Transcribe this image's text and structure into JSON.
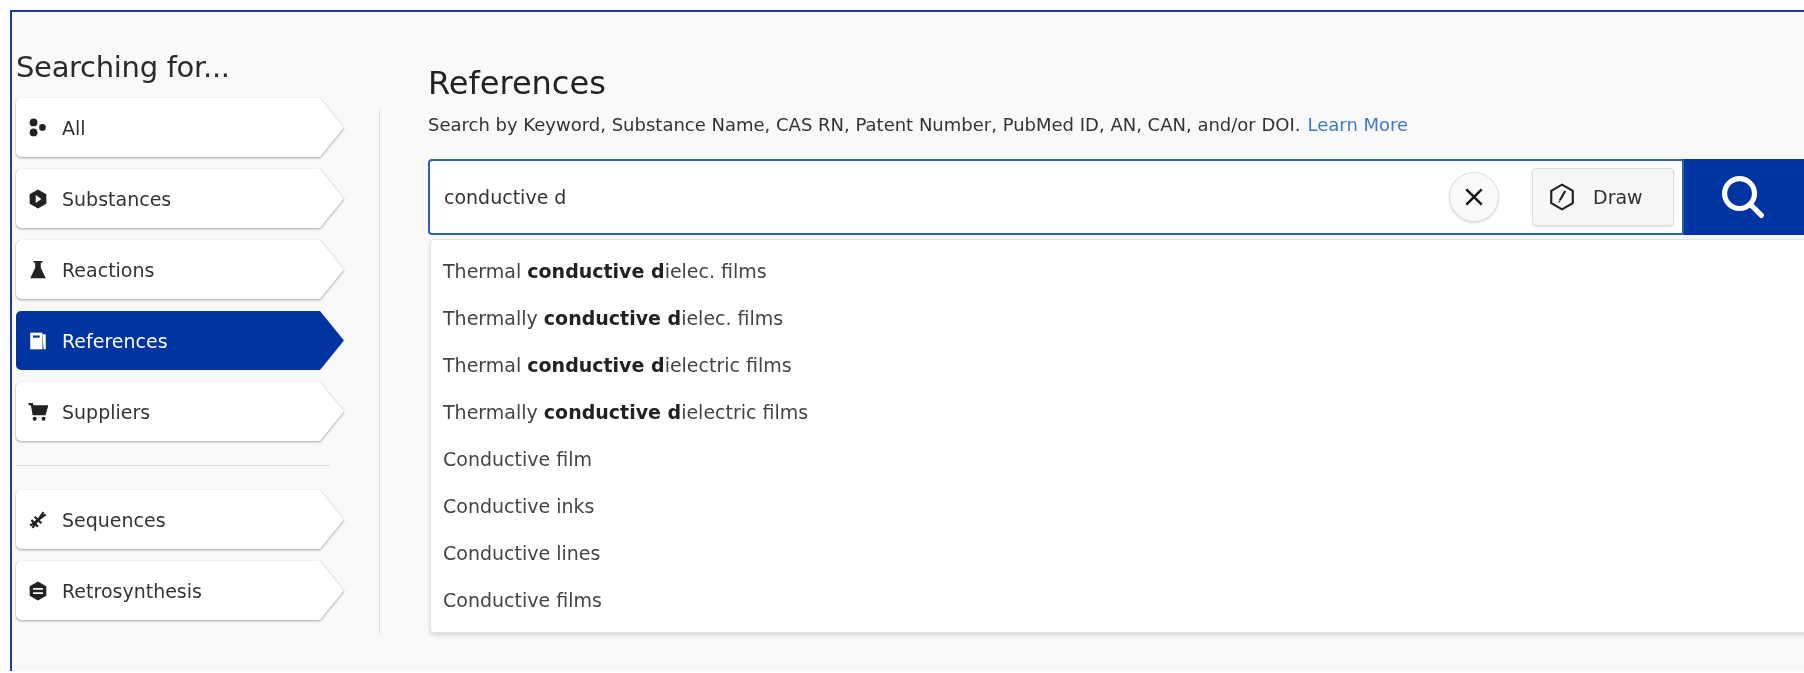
{
  "sidebar": {
    "title": "Searching for...",
    "groups": [
      {
        "items": [
          {
            "label": "All",
            "selected": false
          },
          {
            "label": "Substances",
            "selected": false
          },
          {
            "label": "Reactions",
            "selected": false
          },
          {
            "label": "References",
            "selected": true
          },
          {
            "label": "Suppliers",
            "selected": false
          }
        ]
      },
      {
        "items": [
          {
            "label": "Sequences",
            "selected": false
          },
          {
            "label": "Retrosynthesis",
            "selected": false
          }
        ]
      }
    ]
  },
  "main": {
    "title": "References",
    "description": "Search by Keyword, Substance Name, CAS RN, Patent Number, PubMed ID, AN, CAN, and/or DOI.",
    "link": "Learn More",
    "search": {
      "value": "conductive d",
      "draw_button": "Draw"
    },
    "suggestions": [
      "Thermal **conductive d**ielec. films",
      "Thermally **conductive d**ielec. films",
      "Thermal **conductive d**ielectric films",
      "Thermally **conductive d**ielectric films",
      "Conductive film",
      "Conductive inks",
      "Conductive lines",
      "Conductive films"
    ]
  }
}
